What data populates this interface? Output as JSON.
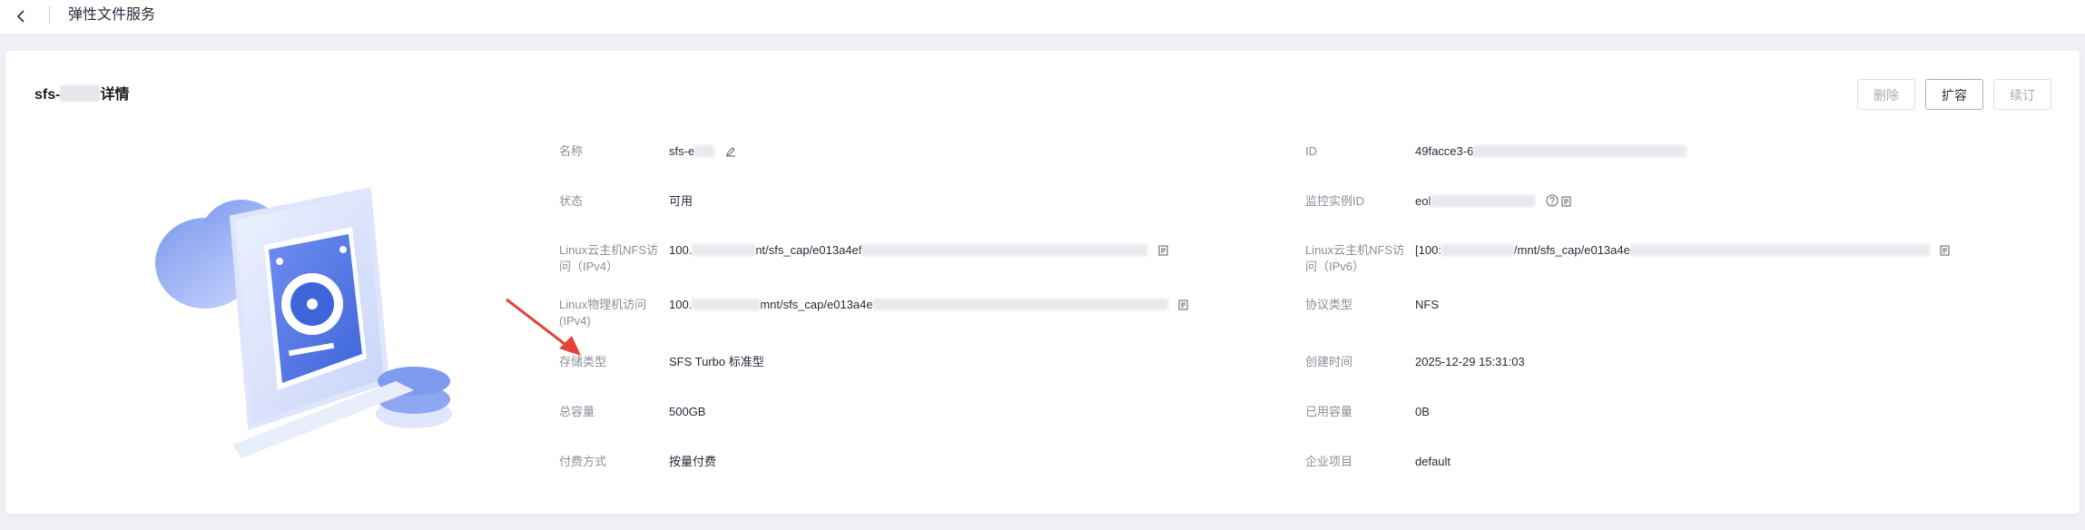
{
  "topbar": {
    "title": "弹性文件服务",
    "back_icon": "chevron-left-icon"
  },
  "detail": {
    "title_prefix": "sfs-",
    "title_suffix": "详情",
    "buttons": {
      "delete": "删除",
      "expand": "扩容",
      "renew": "续订"
    },
    "fields_left": [
      {
        "label": "名称",
        "value": "sfs-e",
        "icon": "edit-icon"
      },
      {
        "label": "状态",
        "value": "可用"
      },
      {
        "label": "Linux云主机NFS访问（IPv4）",
        "value_prefix": "100.",
        "value_mid": "nt/sfs_cap/e013a4ef",
        "icon": "copy-icon"
      },
      {
        "label": "Linux物理机访问(IPv4)",
        "value_prefix": "100.",
        "value_mid": "mnt/sfs_cap/e013a4e",
        "icon": "copy-icon"
      },
      {
        "label": "存储类型",
        "value": "SFS Turbo 标准型"
      },
      {
        "label": "总容量",
        "value": "500GB"
      },
      {
        "label": "付费方式",
        "value": "按量付费"
      }
    ],
    "fields_right": [
      {
        "label": "ID",
        "value": "49facce3-6"
      },
      {
        "label": "监控实例ID",
        "value": "eol",
        "icons": [
          "help-icon",
          "copy-icon"
        ]
      },
      {
        "label": "Linux云主机NFS访问（IPv6）",
        "value_prefix": "[100:",
        "value_mid": "/mnt/sfs_cap/e013a4e",
        "icon": "copy-icon"
      },
      {
        "label": "协议类型",
        "value": "NFS"
      },
      {
        "label": "创建时间",
        "value": "2025-12-29 15:31:03"
      },
      {
        "label": "已用容量",
        "value": "0B"
      },
      {
        "label": "企业项目",
        "value": "default"
      }
    ]
  },
  "colors": {
    "accent": "#5e7ce0",
    "annotation_arrow": "#e8413a"
  }
}
